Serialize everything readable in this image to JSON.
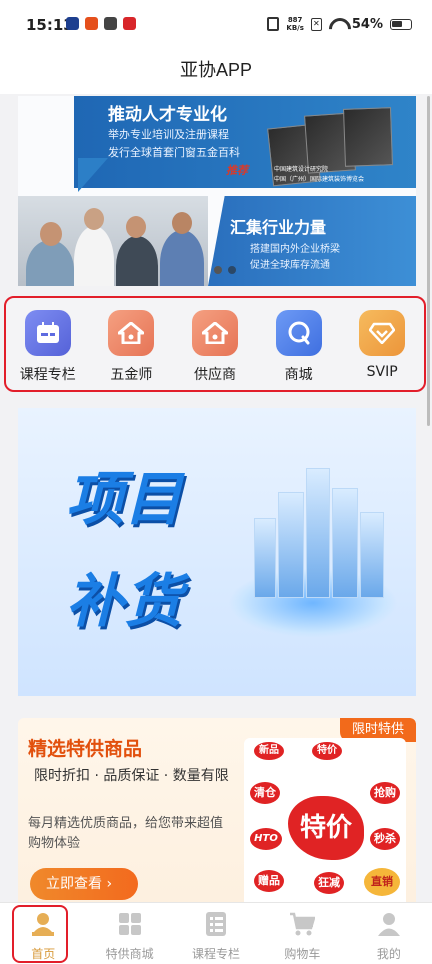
{
  "status_bar": {
    "time": "15:13",
    "net_speed_value": "887",
    "net_speed_unit": "KB/s",
    "battery": "54%"
  },
  "header": {
    "title": "亚协APP"
  },
  "banner": {
    "slide1": {
      "headline": "推动人才专业化",
      "line1": "举办专业培训及注册课程",
      "line2": "发行全球首套门窗五金百科",
      "recommend": "推荐",
      "small1": "中国建筑设计研究院",
      "small2": "中国（广州）国际建筑装饰博览会"
    },
    "slide2": {
      "headline": "汇集行业力量",
      "line1": "搭建国内外企业桥梁",
      "line2": "促进全球库存流通"
    }
  },
  "categories": [
    {
      "label": "课程专栏",
      "icon": "calendar-card-icon",
      "color": "#6a7be8"
    },
    {
      "label": "五金师",
      "icon": "house-icon",
      "color": "#f08a6a"
    },
    {
      "label": "供应商",
      "icon": "house-icon",
      "color": "#f08a6a"
    },
    {
      "label": "商城",
      "icon": "shop-q-icon",
      "color": "#5a86ee"
    },
    {
      "label": "SVIP",
      "icon": "diamond-icon",
      "color": "#f0a94a"
    }
  ],
  "project_banner": {
    "line1": "项目",
    "line2": "补货"
  },
  "promo": {
    "title": "精选特供商品",
    "tagline": "限时折扣 · 品质保证 · 数量有限",
    "desc": "每月精选优质商品，给您带来超值购物体验",
    "button": "立即查看",
    "corner_tag": "限时特供",
    "stickers": [
      "特价",
      "清仓",
      "抢购",
      "HTO",
      "秒杀",
      "赠品",
      "狂减",
      "直销",
      "新品",
      "特价"
    ]
  },
  "tabbar": [
    {
      "label": "首页",
      "icon": "home-person-icon",
      "active": true
    },
    {
      "label": "特供商城",
      "icon": "grid-icon",
      "active": false
    },
    {
      "label": "课程专栏",
      "icon": "list-icon",
      "active": false
    },
    {
      "label": "购物车",
      "icon": "cart-icon",
      "active": false
    },
    {
      "label": "我的",
      "icon": "user-icon",
      "active": false
    }
  ],
  "colors": {
    "accent": "#f26a1b",
    "highlight_box": "#e21e2a",
    "active_tab": "#d89a3a"
  }
}
